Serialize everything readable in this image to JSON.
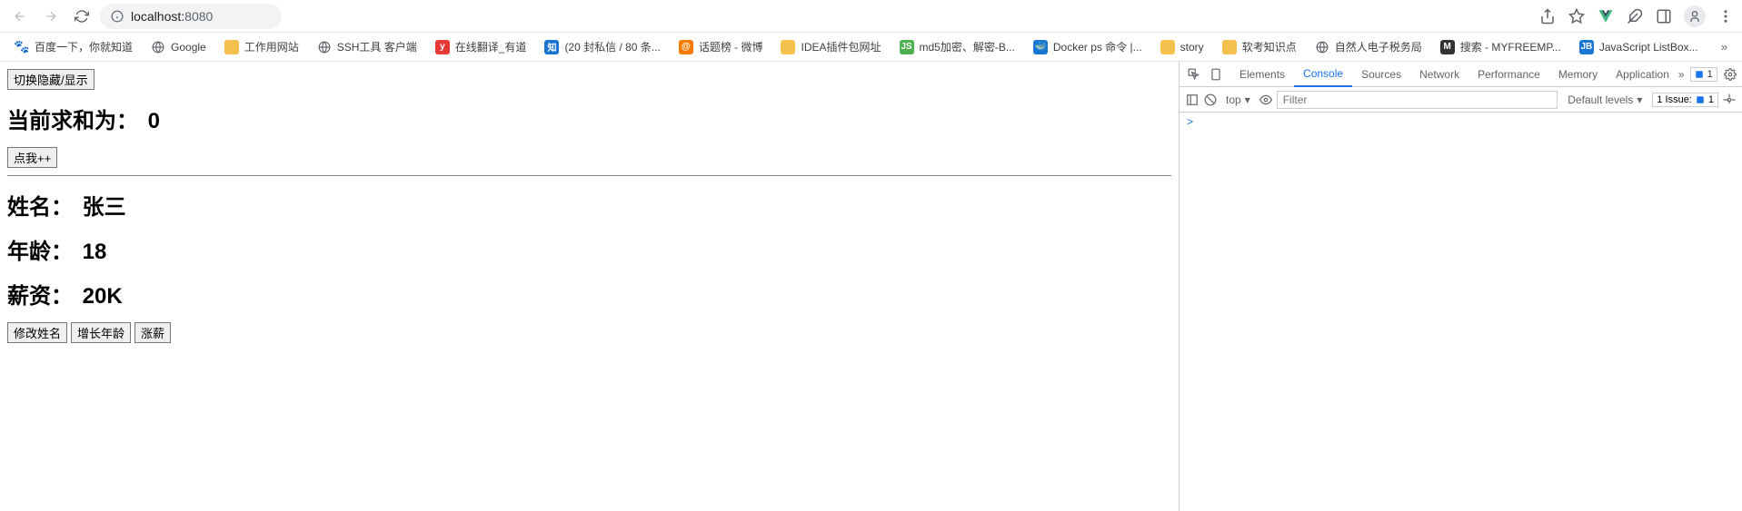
{
  "browser": {
    "url_host": "localhost:",
    "url_port": "8080"
  },
  "bookmarks": [
    {
      "label": "百度一下，你就知道",
      "icon": "baidu"
    },
    {
      "label": "Google",
      "icon": "globe"
    },
    {
      "label": "工作用网站",
      "icon": "folder"
    },
    {
      "label": "SSH工具 客户端",
      "icon": "globe"
    },
    {
      "label": "在线翻译_有道",
      "icon": "red-y"
    },
    {
      "label": "(20 封私信 / 80 条...",
      "icon": "blue-zhi"
    },
    {
      "label": "话题榜 - 微博",
      "icon": "orange-weibo"
    },
    {
      "label": "IDEA插件包网址",
      "icon": "folder"
    },
    {
      "label": "md5加密、解密-B...",
      "icon": "green-js"
    },
    {
      "label": "Docker ps 命令 |...",
      "icon": "blue-docker"
    },
    {
      "label": "story",
      "icon": "folder"
    },
    {
      "label": "软考知识点",
      "icon": "folder"
    },
    {
      "label": "自然人电子税务局",
      "icon": "globe"
    },
    {
      "label": "搜索 - MYFREEMP...",
      "icon": "dark-m"
    },
    {
      "label": "JavaScript ListBox...",
      "icon": "blue-jb"
    }
  ],
  "page": {
    "toggle_btn": "切换隐藏/显示",
    "sum_label": "当前求和为：",
    "sum_value": "0",
    "inc_btn": "点我++",
    "name_label": "姓名：",
    "name_value": "张三",
    "age_label": "年龄：",
    "age_value": "18",
    "salary_label": "薪资：",
    "salary_value": "20K",
    "btn_name": "修改姓名",
    "btn_age": "增长年龄",
    "btn_salary": "涨薪"
  },
  "devtools": {
    "tabs": [
      "Elements",
      "Console",
      "Sources",
      "Network",
      "Performance",
      "Memory",
      "Application"
    ],
    "active_tab": "Console",
    "warn_count": "1",
    "context": "top",
    "filter_placeholder": "Filter",
    "levels": "Default levels",
    "issues_label": "1 Issue:",
    "issues_count": "1",
    "prompt": ">"
  }
}
